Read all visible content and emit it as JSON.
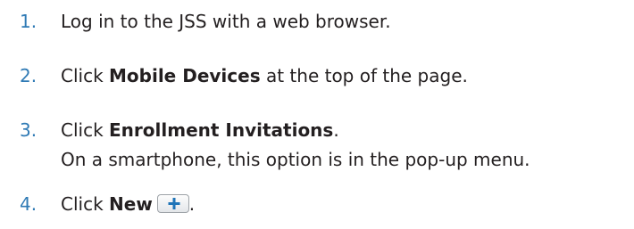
{
  "steps": [
    {
      "number": "1.",
      "text": "Log in to the JSS with a web browser."
    },
    {
      "number": "2.",
      "prefix": "Click ",
      "bold": "Mobile Devices",
      "suffix": " at the top of the page."
    },
    {
      "number": "3.",
      "prefix": "Click ",
      "bold": "Enrollment Invitations",
      "suffix": ".",
      "note": "On a smartphone, this option is in the pop-up menu."
    },
    {
      "number": "4.",
      "prefix": "Click ",
      "bold": "New",
      "suffix": ".",
      "button_icon": "plus-icon"
    }
  ],
  "colors": {
    "number": "#2f7ab5",
    "text": "#231f20",
    "plus_icon": "#1f74b8"
  }
}
